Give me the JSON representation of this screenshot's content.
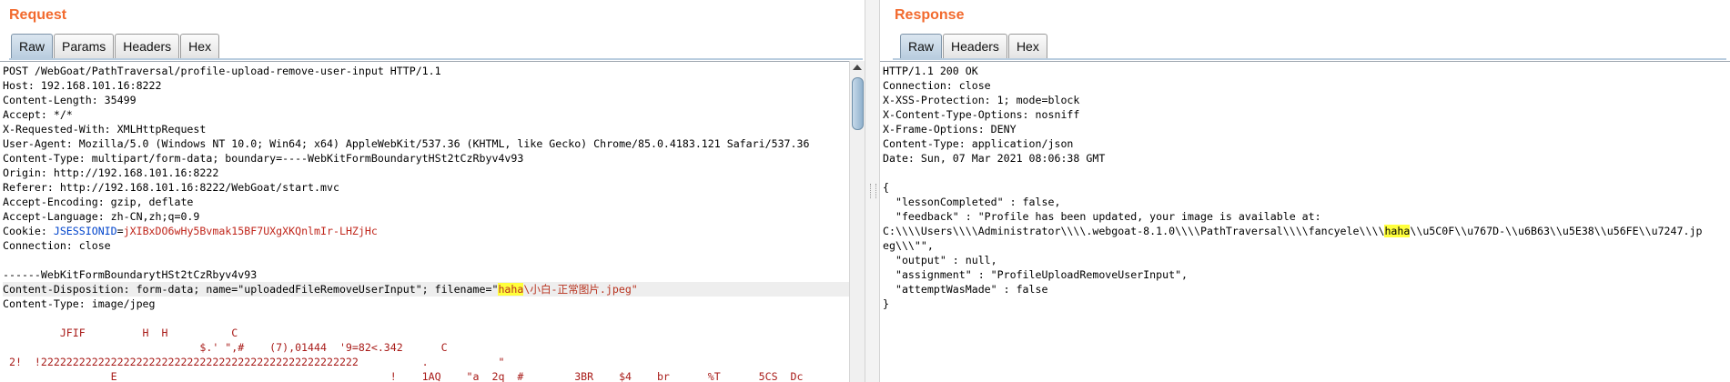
{
  "request": {
    "title": "Request",
    "tabs": [
      "Raw",
      "Params",
      "Headers",
      "Hex"
    ],
    "active_tab": "Raw",
    "lines": {
      "request_line": "POST /WebGoat/PathTraversal/profile-upload-remove-user-input HTTP/1.1",
      "host": "Host: 192.168.101.16:8222",
      "content_length": "Content-Length: 35499",
      "accept": "Accept: */*",
      "x_requested_with": "X-Requested-With: XMLHttpRequest",
      "user_agent": "User-Agent: Mozilla/5.0 (Windows NT 10.0; Win64; x64) AppleWebKit/537.36 (KHTML, like Gecko) Chrome/85.0.4183.121 Safari/537.36",
      "content_type": "Content-Type: multipart/form-data; boundary=----WebKitFormBoundarytHSt2tCzRbyv4v93",
      "origin": "Origin: http://192.168.101.16:8222",
      "referer": "Referer: http://192.168.101.16:8222/WebGoat/start.mvc",
      "accept_encoding": "Accept-Encoding: gzip, deflate",
      "accept_language": "Accept-Language: zh-CN,zh;q=0.9",
      "cookie_prefix": "Cookie: ",
      "cookie_name": "JSESSIONID",
      "cookie_eq": "=",
      "cookie_value": "jXIBxDO6wHy5Bvmak15BF7UXgXKQnlmIr-LHZjHc",
      "connection": "Connection: close",
      "blank": "",
      "boundary": "------WebKitFormBoundarytHSt2tCzRbyv4v93",
      "disposition_prefix": "Content-Disposition: form-data; name=\"uploadedFileRemoveUserInput\"; filename=\"",
      "filename_highlight": "haha",
      "filename_rest": "\\小白-正常图片.jpeg\"",
      "part_content_type": "Content-Type: image/jpeg",
      "binary1": "         JFIF         H  H          C",
      "binary2": "                               $.' \",#    (7),01444  '9=82<.342      C",
      "binary3": " 2!  !22222222222222222222222222222222222222222222222222          .           \"",
      "binary4": "                 E                                           !    1AQ    \"a  2q  #        3BR    $4    br      %T      5CS  Dc"
    }
  },
  "response": {
    "title": "Response",
    "tabs": [
      "Raw",
      "Headers",
      "Hex"
    ],
    "active_tab": "Raw",
    "lines": {
      "status": "HTTP/1.1 200 OK",
      "connection": "Connection: close",
      "xss": "X-XSS-Protection: 1; mode=block",
      "cto": "X-Content-Type-Options: nosniff",
      "xfo": "X-Frame-Options: DENY",
      "content_type": "Content-Type: application/json",
      "date": "Date: Sun, 07 Mar 2021 08:06:38 GMT",
      "blank": "",
      "brace_open": "{",
      "lesson": "  \"lessonCompleted\" : false,",
      "feedback": "  \"feedback\" : \"Profile has been updated, your image is available at:",
      "path_prefix": "C:\\\\\\\\Users\\\\\\\\Administrator\\\\\\\\.webgoat-8.1.0\\\\\\\\PathTraversal\\\\\\\\fancyele\\\\\\\\",
      "path_highlight": "haha",
      "path_rest": "\\\\u5C0F\\\\u767D-\\\\u6B63\\\\u5E38\\\\u56FE\\\\u7247.jp",
      "path_cont": "eg\\\\\\\"\",",
      "output": "  \"output\" : null,",
      "assignment": "  \"assignment\" : \"ProfileUploadRemoveUserInput\",",
      "attempt": "  \"attemptWasMade\" : false",
      "brace_close": "}"
    }
  }
}
